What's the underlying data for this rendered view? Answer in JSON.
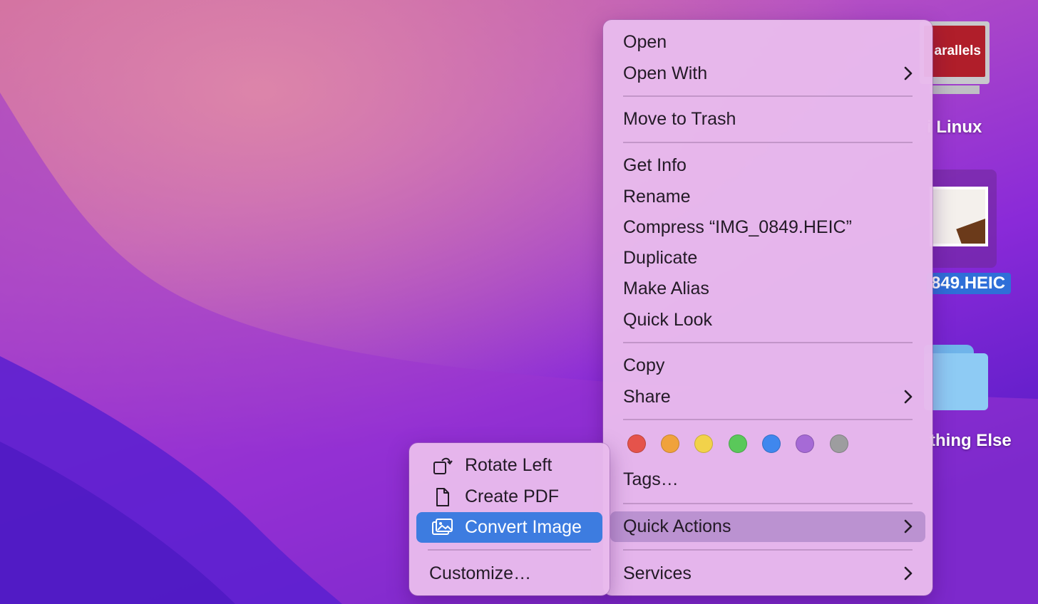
{
  "desktop_icons": [
    {
      "label": "i Linux",
      "badge": "arallels"
    },
    {
      "label": "849.HEIC"
    },
    {
      "label": "thing Else"
    }
  ],
  "context_menu": {
    "items": [
      {
        "label": "Open"
      },
      {
        "label": "Open With",
        "submenu": true
      },
      {
        "label": "Move to Trash"
      },
      {
        "label": "Get Info"
      },
      {
        "label": "Rename"
      },
      {
        "label": "Compress “IMG_0849.HEIC”"
      },
      {
        "label": "Duplicate"
      },
      {
        "label": "Make Alias"
      },
      {
        "label": "Quick Look"
      },
      {
        "label": "Copy"
      },
      {
        "label": "Share",
        "submenu": true
      },
      {
        "label": "Tags…"
      },
      {
        "label": "Quick Actions",
        "submenu": true,
        "highlighted": true
      },
      {
        "label": "Services",
        "submenu": true
      }
    ],
    "tag_colors": [
      {
        "name": "red",
        "color": "#e5534b"
      },
      {
        "name": "orange",
        "color": "#f0a23c"
      },
      {
        "name": "yellow",
        "color": "#f2d24a"
      },
      {
        "name": "green",
        "color": "#5ac85a"
      },
      {
        "name": "blue",
        "color": "#3f87ee"
      },
      {
        "name": "purple",
        "color": "#a66ad6"
      },
      {
        "name": "gray",
        "color": "#9d9d9f"
      }
    ]
  },
  "quick_actions_submenu": {
    "items": [
      {
        "label": "Rotate Left",
        "icon": "rotate-left-icon"
      },
      {
        "label": "Create PDF",
        "icon": "document-icon"
      },
      {
        "label": "Convert Image",
        "icon": "photos-icon",
        "selected": true
      },
      {
        "label": "Customize…"
      }
    ]
  },
  "colors": {
    "selection_blue": "#3d7ce0",
    "menu_bg": "#e8baec"
  }
}
